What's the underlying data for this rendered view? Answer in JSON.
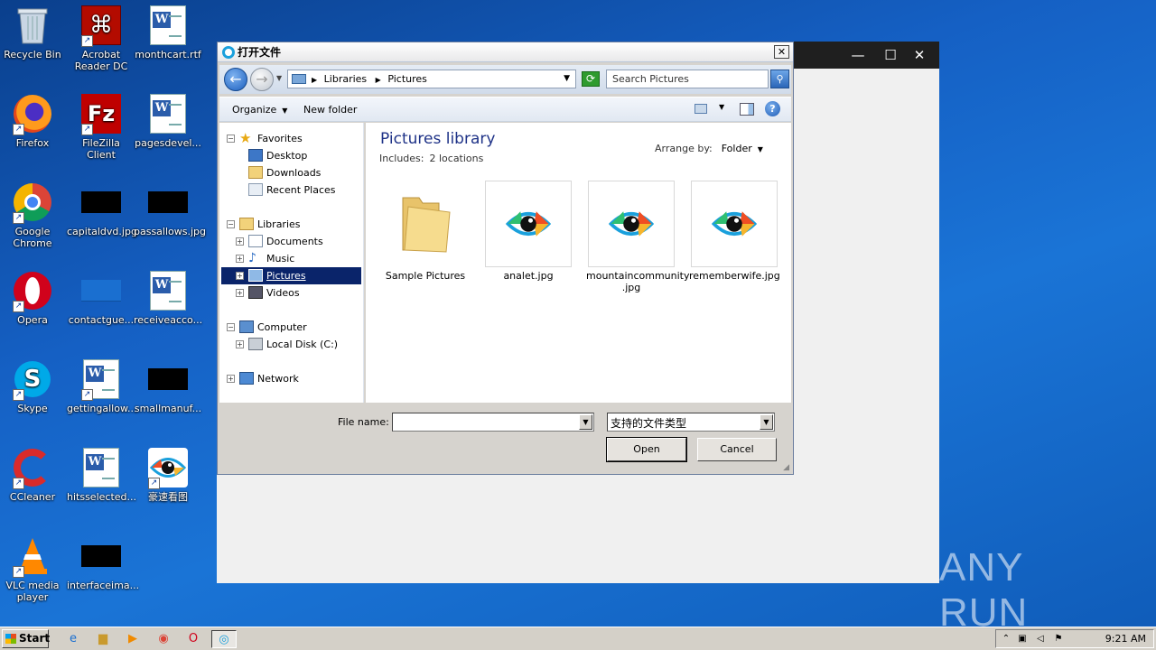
{
  "desktop": {
    "icons": [
      {
        "label": "Recycle Bin"
      },
      {
        "label": "Acrobat Reader DC"
      },
      {
        "label": "monthcart.rtf"
      },
      {
        "label": "Firefox"
      },
      {
        "label": "FileZilla Client"
      },
      {
        "label": "pagesdevel..."
      },
      {
        "label": "Google Chrome"
      },
      {
        "label": "capitaldvd.jpg"
      },
      {
        "label": "passallows.jpg"
      },
      {
        "label": "Opera"
      },
      {
        "label": "contactgue..."
      },
      {
        "label": "receiveacco..."
      },
      {
        "label": "Skype"
      },
      {
        "label": "gettingallow..."
      },
      {
        "label": "smallmanuf..."
      },
      {
        "label": "CCleaner"
      },
      {
        "label": "hitsselected..."
      },
      {
        "label": "豪速看图"
      },
      {
        "label": "VLC media player"
      },
      {
        "label": "interfaceima..."
      }
    ]
  },
  "dialog": {
    "title": "打开文件",
    "close_glyph": "✕",
    "address": {
      "crumbs": [
        "Libraries",
        "Pictures"
      ]
    },
    "search_placeholder": "Search Pictures",
    "toolbar": {
      "organize": "Organize",
      "new_folder": "New folder",
      "help": "?"
    },
    "nav": {
      "favorites": "Favorites",
      "desktop": "Desktop",
      "downloads": "Downloads",
      "recent": "Recent Places",
      "libraries": "Libraries",
      "documents": "Documents",
      "music": "Music",
      "pictures": "Pictures",
      "videos": "Videos",
      "computer": "Computer",
      "local_disk": "Local Disk (C:)",
      "network": "Network"
    },
    "content": {
      "title": "Pictures library",
      "includes_label": "Includes:",
      "includes_value": "2 locations",
      "arrange_label": "Arrange by:",
      "arrange_value": "Folder",
      "items": [
        {
          "name": "Sample Pictures",
          "type": "folder"
        },
        {
          "name": "analet.jpg",
          "type": "image"
        },
        {
          "name": "mountaincommunity .jpg",
          "type": "image"
        },
        {
          "name": "rememberwife.jpg",
          "type": "image"
        }
      ]
    },
    "file_name_label": "File name:",
    "file_name_value": "",
    "filter_value": "支持的文件类型",
    "open_label": "Open",
    "cancel_label": "Cancel"
  },
  "bg_window": {
    "min": "—",
    "max": "☐",
    "close": "✕"
  },
  "taskbar": {
    "start": "Start",
    "clock": "9:21 AM"
  },
  "watermark": "ANY RUN",
  "colors": {
    "selection": "#0a246a",
    "library_title": "#1e3287",
    "taskbar": "#d4d0c8"
  }
}
